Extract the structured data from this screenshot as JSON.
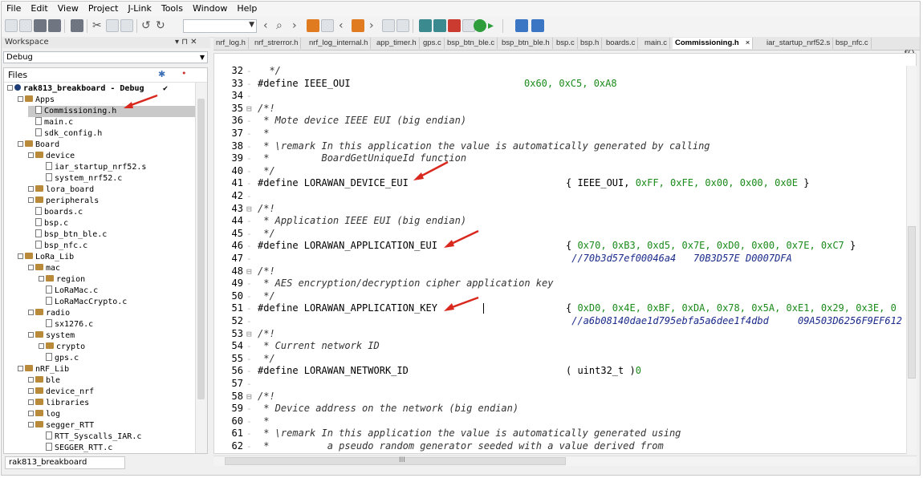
{
  "menu": [
    "File",
    "Edit",
    "View",
    "Project",
    "J-Link",
    "Tools",
    "Window",
    "Help"
  ],
  "workspace": {
    "title": "Workspace",
    "pin": "▾ ⊓ ✕",
    "config": "Debug",
    "files_label": "Files",
    "bottom_tab": "rak813_breakboard",
    "tree": [
      {
        "text": "rak813_breakboard - Debug",
        "indent": 0,
        "type": "project",
        "check": "✔"
      },
      {
        "text": "Apps",
        "indent": 1,
        "type": "folder"
      },
      {
        "text": "Commissioning.h",
        "indent": 2,
        "type": "file",
        "selected": true
      },
      {
        "text": "main.c",
        "indent": 2,
        "type": "file"
      },
      {
        "text": "sdk_config.h",
        "indent": 2,
        "type": "file"
      },
      {
        "text": "Board",
        "indent": 1,
        "type": "folder"
      },
      {
        "text": "device",
        "indent": 2,
        "type": "folder"
      },
      {
        "text": "iar_startup_nrf52.s",
        "indent": 3,
        "type": "file"
      },
      {
        "text": "system_nrf52.c",
        "indent": 3,
        "type": "file"
      },
      {
        "text": "lora_board",
        "indent": 2,
        "type": "folder"
      },
      {
        "text": "peripherals",
        "indent": 2,
        "type": "folder"
      },
      {
        "text": "boards.c",
        "indent": 2,
        "type": "file"
      },
      {
        "text": "bsp.c",
        "indent": 2,
        "type": "file"
      },
      {
        "text": "bsp_btn_ble.c",
        "indent": 2,
        "type": "file"
      },
      {
        "text": "bsp_nfc.c",
        "indent": 2,
        "type": "file"
      },
      {
        "text": "LoRa_Lib",
        "indent": 1,
        "type": "folder"
      },
      {
        "text": "mac",
        "indent": 2,
        "type": "folder"
      },
      {
        "text": "region",
        "indent": 3,
        "type": "folder"
      },
      {
        "text": "LoRaMac.c",
        "indent": 3,
        "type": "file"
      },
      {
        "text": "LoRaMacCrypto.c",
        "indent": 3,
        "type": "file"
      },
      {
        "text": "radio",
        "indent": 2,
        "type": "folder"
      },
      {
        "text": "sx1276.c",
        "indent": 3,
        "type": "file"
      },
      {
        "text": "system",
        "indent": 2,
        "type": "folder"
      },
      {
        "text": "crypto",
        "indent": 3,
        "type": "folder"
      },
      {
        "text": "gps.c",
        "indent": 3,
        "type": "file"
      },
      {
        "text": "nRF_Lib",
        "indent": 1,
        "type": "folder"
      },
      {
        "text": "ble",
        "indent": 2,
        "type": "folder"
      },
      {
        "text": "device_nrf",
        "indent": 2,
        "type": "folder"
      },
      {
        "text": "libraries",
        "indent": 2,
        "type": "folder"
      },
      {
        "text": "log",
        "indent": 2,
        "type": "folder"
      },
      {
        "text": "segger_RTT",
        "indent": 2,
        "type": "folder"
      },
      {
        "text": "RTT_Syscalls_IAR.c",
        "indent": 3,
        "type": "file"
      },
      {
        "text": "SEGGER_RTT.c",
        "indent": 3,
        "type": "file"
      }
    ]
  },
  "tabs": [
    {
      "label": "nrf_log.h"
    },
    {
      "label": "nrf_strerror.h"
    },
    {
      "label": "nrf_log_internal.h"
    },
    {
      "label": "app_timer.h"
    },
    {
      "label": "gps.c"
    },
    {
      "label": "bsp_btn_ble.c"
    },
    {
      "label": "bsp_btn_ble.h"
    },
    {
      "label": "bsp.c"
    },
    {
      "label": "bsp.h"
    },
    {
      "label": "boards.c"
    },
    {
      "label": "main.c"
    },
    {
      "label": "Commissioning.h",
      "active": true
    },
    {
      "label": "iar_startup_nrf52.s"
    },
    {
      "label": "bsp_nfc.c"
    }
  ],
  "tab_close": "×",
  "editor_corner": "f()",
  "code": [
    {
      "n": "32",
      "fold": "",
      "parts": [
        {
          "t": "  */",
          "c": "com"
        }
      ]
    },
    {
      "n": "33",
      "fold": "",
      "parts": [
        {
          "t": "#define IEEE_OUI",
          "c": "def"
        },
        {
          "t": "0x60, 0xC5, 0xA8",
          "c": "val",
          "col": 2
        }
      ]
    },
    {
      "n": "34",
      "fold": "",
      "parts": []
    },
    {
      "n": "35",
      "fold": "⊟",
      "parts": [
        {
          "t": "/*!",
          "c": "com"
        }
      ]
    },
    {
      "n": "36",
      "fold": "",
      "parts": [
        {
          "t": " * Mote device IEEE EUI (big endian)",
          "c": "com"
        }
      ]
    },
    {
      "n": "37",
      "fold": "",
      "parts": [
        {
          "t": " *",
          "c": "com"
        }
      ]
    },
    {
      "n": "38",
      "fold": "",
      "parts": [
        {
          "t": " * \\remark In this application the value is automatically generated by calling",
          "c": "com"
        }
      ]
    },
    {
      "n": "39",
      "fold": "",
      "parts": [
        {
          "t": " *         BoardGetUniqueId function",
          "c": "com"
        }
      ]
    },
    {
      "n": "40",
      "fold": "",
      "parts": [
        {
          "t": " */",
          "c": "com"
        }
      ]
    },
    {
      "n": "41",
      "fold": "",
      "parts": [
        {
          "t": "#define LORAWAN_DEVICE_EUI",
          "c": "def"
        },
        {
          "t": "{ IEEE_OUI, ",
          "c": "def",
          "col": 1
        },
        {
          "t": "0xFF, 0xFE, 0x00, 0x00, 0x0E",
          "c": "val"
        },
        {
          "t": " }",
          "c": "def"
        }
      ]
    },
    {
      "n": "42",
      "fold": "",
      "parts": []
    },
    {
      "n": "43",
      "fold": "⊟",
      "parts": [
        {
          "t": "/*!",
          "c": "com"
        }
      ]
    },
    {
      "n": "44",
      "fold": "",
      "parts": [
        {
          "t": " * Application IEEE EUI (big endian)",
          "c": "com"
        }
      ]
    },
    {
      "n": "45",
      "fold": "",
      "parts": [
        {
          "t": " */",
          "c": "com"
        }
      ]
    },
    {
      "n": "46",
      "fold": "",
      "parts": [
        {
          "t": "#define LORAWAN_APPLICATION_EUI",
          "c": "def"
        },
        {
          "t": "{ ",
          "c": "def",
          "col": 1
        },
        {
          "t": "0x70, 0xB3, 0xd5, 0x7E, 0xD0, 0x00, 0x7E, 0xC7",
          "c": "val"
        },
        {
          "t": " }",
          "c": "def"
        }
      ]
    },
    {
      "n": "47",
      "fold": "",
      "parts": [
        {
          "t": " //70b3d57ef00046a4   70B3D57E D0007DFA",
          "c": "str",
          "col": 1
        }
      ]
    },
    {
      "n": "48",
      "fold": "⊟",
      "parts": [
        {
          "t": "/*!",
          "c": "com"
        }
      ]
    },
    {
      "n": "49",
      "fold": "",
      "parts": [
        {
          "t": " * AES encryption/decryption cipher application key",
          "c": "com"
        }
      ]
    },
    {
      "n": "50",
      "fold": "",
      "parts": [
        {
          "t": " */",
          "c": "com"
        }
      ]
    },
    {
      "n": "51",
      "fold": "",
      "parts": [
        {
          "t": "#define LORAWAN_APPLICATION_KEY",
          "c": "def"
        },
        {
          "t": "{ ",
          "c": "def",
          "col": 1
        },
        {
          "t": "0xD0, 0x4E, 0xBF, 0xDA, 0x78, 0x5A, 0xE1, 0x29, 0x3E, 0",
          "c": "val"
        }
      ]
    },
    {
      "n": "52",
      "fold": "",
      "parts": [
        {
          "t": " //a6b08140dae1d795ebfa5a6dee1f4dbd     09A503D6256F9EF612",
          "c": "str",
          "col": 1
        }
      ]
    },
    {
      "n": "53",
      "fold": "⊟",
      "parts": [
        {
          "t": "/*!",
          "c": "com"
        }
      ]
    },
    {
      "n": "54",
      "fold": "",
      "parts": [
        {
          "t": " * Current network ID",
          "c": "com"
        }
      ]
    },
    {
      "n": "55",
      "fold": "",
      "parts": [
        {
          "t": " */",
          "c": "com"
        }
      ]
    },
    {
      "n": "56",
      "fold": "",
      "parts": [
        {
          "t": "#define LORAWAN_NETWORK_ID",
          "c": "def"
        },
        {
          "t": "( uint32_t )",
          "c": "def",
          "col": 1
        },
        {
          "t": "0",
          "c": "val"
        }
      ]
    },
    {
      "n": "57",
      "fold": "",
      "parts": []
    },
    {
      "n": "58",
      "fold": "⊟",
      "parts": [
        {
          "t": "/*!",
          "c": "com"
        }
      ]
    },
    {
      "n": "59",
      "fold": "",
      "parts": [
        {
          "t": " * Device address on the network (big endian)",
          "c": "com"
        }
      ]
    },
    {
      "n": "60",
      "fold": "",
      "parts": [
        {
          "t": " *",
          "c": "com"
        }
      ]
    },
    {
      "n": "61",
      "fold": "",
      "parts": [
        {
          "t": " * \\remark In this application the value is automatically generated using",
          "c": "com"
        }
      ]
    },
    {
      "n": "62",
      "fold": "",
      "parts": [
        {
          "t": " *          a pseudo random generator seeded with a value derived from",
          "c": "com"
        }
      ]
    }
  ],
  "colors": {
    "accent_arrow": "#d9281e",
    "value_green": "#1a8a1a",
    "selected_row": "#c9c9c9"
  }
}
